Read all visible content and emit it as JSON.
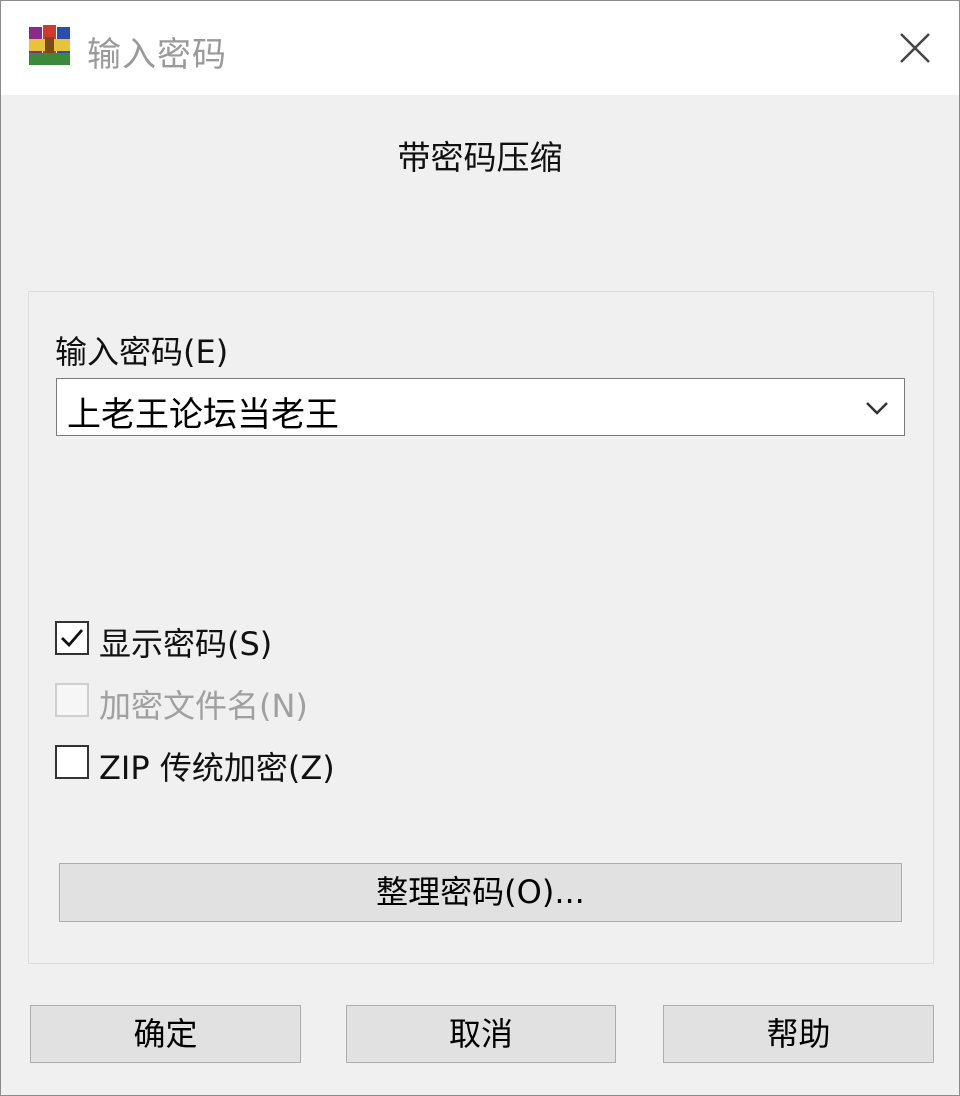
{
  "window": {
    "title": "输入密码",
    "heading": "带密码压缩"
  },
  "password": {
    "label": "输入密码(E)",
    "value": "上老王论坛当老王"
  },
  "options": {
    "show_password": {
      "label": "显示密码(S)",
      "checked": true,
      "enabled": true
    },
    "encrypt_filenames": {
      "label": "加密文件名(N)",
      "checked": false,
      "enabled": false
    },
    "zip_legacy": {
      "label": "ZIP 传统加密(Z)",
      "checked": false,
      "enabled": true
    }
  },
  "buttons": {
    "organize": "整理密码(O)...",
    "ok": "确定",
    "cancel": "取消",
    "help": "帮助"
  },
  "icons": {
    "app": "winrar-books-icon",
    "close": "close-icon",
    "dropdown": "chevron-down-icon",
    "check": "checkmark-icon"
  }
}
